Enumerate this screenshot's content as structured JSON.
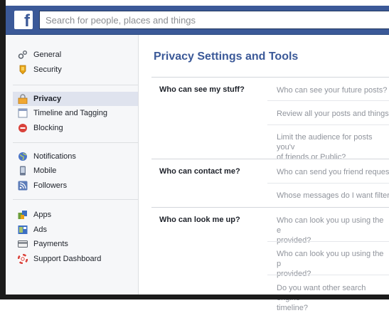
{
  "topbar": {
    "logo": "f",
    "search_placeholder": "Search for people, places and things"
  },
  "sidebar": {
    "groups": [
      {
        "items": [
          {
            "label": "General",
            "icon": "gears-icon"
          },
          {
            "label": "Security",
            "icon": "badge-icon"
          }
        ]
      },
      {
        "items": [
          {
            "label": "Privacy",
            "icon": "lock-icon",
            "selected": true
          },
          {
            "label": "Timeline and Tagging",
            "icon": "timeline-icon"
          },
          {
            "label": "Blocking",
            "icon": "blocking-icon"
          }
        ]
      },
      {
        "items": [
          {
            "label": "Notifications",
            "icon": "globe-icon"
          },
          {
            "label": "Mobile",
            "icon": "mobile-icon"
          },
          {
            "label": "Followers",
            "icon": "rss-icon"
          }
        ]
      },
      {
        "items": [
          {
            "label": "Apps",
            "icon": "apps-icon"
          },
          {
            "label": "Ads",
            "icon": "ads-icon"
          },
          {
            "label": "Payments",
            "icon": "card-icon"
          },
          {
            "label": "Support Dashboard",
            "icon": "lifebuoy-icon"
          }
        ]
      }
    ]
  },
  "main": {
    "title": "Privacy Settings and Tools",
    "sections": [
      {
        "label": "Who can see my stuff?",
        "rows": [
          "Who can see your future posts?",
          "Review all your posts and things y",
          "Limit the audience for posts you'v\nof friends or Public?"
        ]
      },
      {
        "label": "Who can contact me?",
        "rows": [
          "Who can send you friend request",
          "Whose messages do I want filtere"
        ]
      },
      {
        "label": "Who can look me up?",
        "rows": [
          "Who can look you up using the e\nprovided?",
          "Who can look you up using the p\nprovided?",
          "Do you want other search engine\ntimeline?"
        ]
      }
    ]
  },
  "colors": {
    "brand_blue": "#3b5998",
    "sidebar_bg": "#f6f7f9",
    "selected_bg": "#dfe3ee",
    "muted_text": "#90949c"
  }
}
